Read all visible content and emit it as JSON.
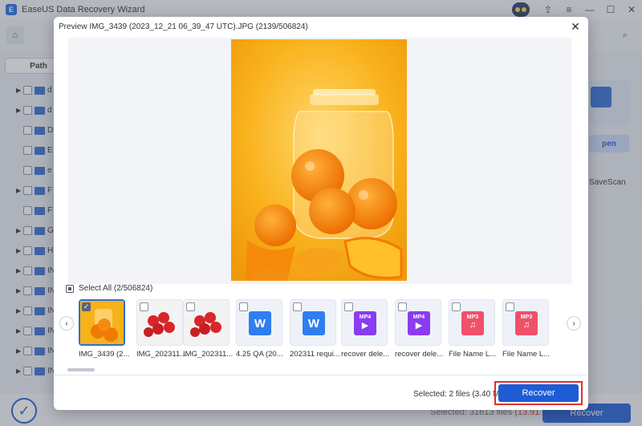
{
  "app": {
    "title": "EaseUS Data Recovery Wizard",
    "path_tab": "Path",
    "tree_labels": [
      "d",
      "d",
      "D",
      "E",
      "e",
      "F",
      "F",
      "G",
      "H",
      "IN",
      "IN",
      "IN",
      "IN",
      "IN",
      "IN"
    ],
    "right_open_label": "pen",
    "right_savescan_label": "SaveScan",
    "bottom_status_prefix": "Selected: 31613 files",
    "bottom_status_size": "(13.91 GB)",
    "bottom_recover_label": "Recover"
  },
  "modal": {
    "title": "Preview IMG_3439 (2023_12_21 06_39_47 UTC).JPG (2139/506824)",
    "select_all_label": "Select All (2/506824)",
    "footer_status": "Selected: 2 files (3.40 MB)",
    "recover_label": "Recover"
  },
  "thumbnails": [
    {
      "name": "IMG_3439 (2...",
      "kind": "photo-oranges",
      "selected": true
    },
    {
      "name": "IMG_202311...",
      "kind": "photo-tomatoes",
      "selected": false
    },
    {
      "name": "IMG_202311...",
      "kind": "photo-tomatoes",
      "selected": false
    },
    {
      "name": "4.25 QA (20...",
      "kind": "word-doc",
      "selected": false
    },
    {
      "name": "202311 requi...",
      "kind": "word-doc",
      "selected": false
    },
    {
      "name": "recover dele...",
      "kind": "mp4-video",
      "selected": false
    },
    {
      "name": "recover dele...",
      "kind": "mp4-video",
      "selected": false
    },
    {
      "name": "File Name L...",
      "kind": "mp3-audio",
      "selected": false
    },
    {
      "name": "File Name L...",
      "kind": "mp3-audio",
      "selected": false
    }
  ],
  "colors": {
    "accent": "#1e5cd6",
    "highlight_border": "#e0302a",
    "preview_background": "#f7b21a"
  }
}
